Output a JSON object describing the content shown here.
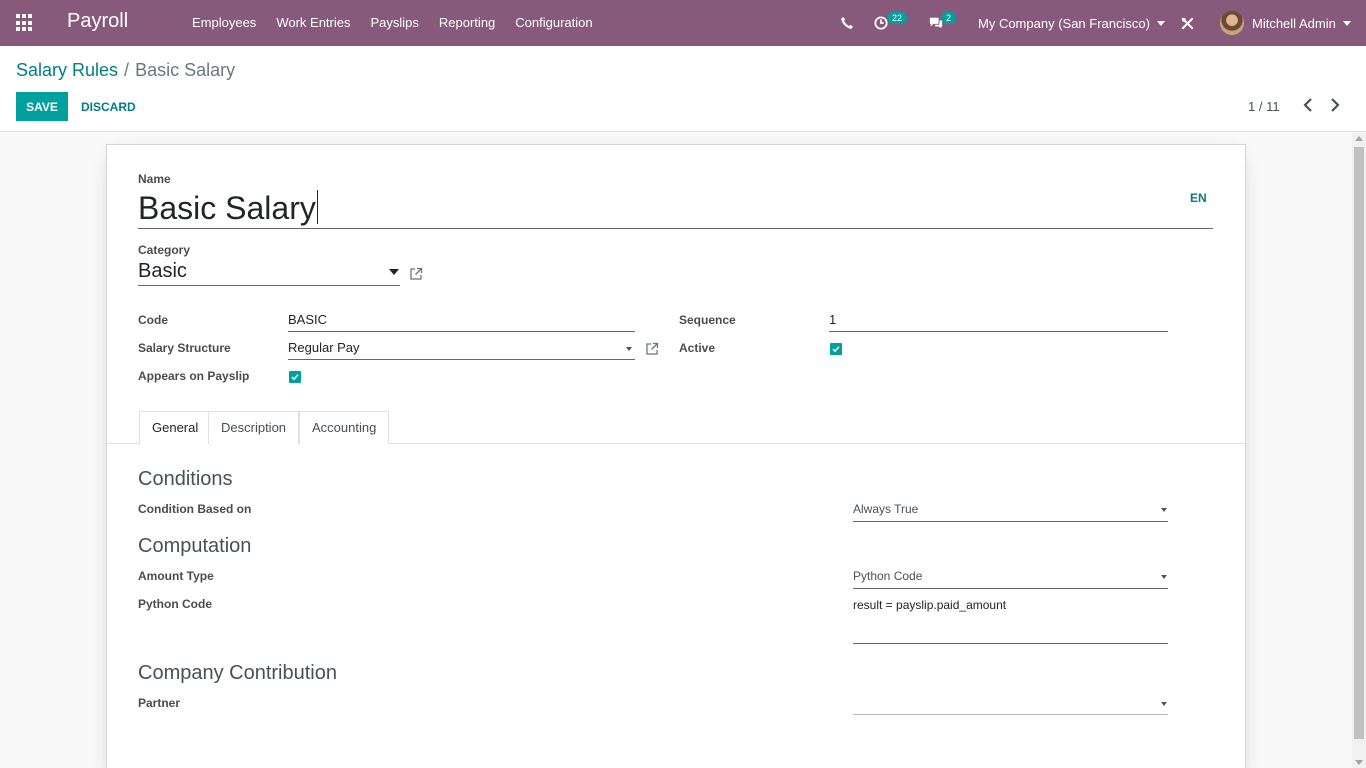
{
  "navbar": {
    "brand": "Payroll",
    "menu": [
      "Employees",
      "Work Entries",
      "Payslips",
      "Reporting",
      "Configuration"
    ],
    "activities_count": "22",
    "messages_count": "2",
    "company": "My Company (San Francisco)",
    "user": "Mitchell Admin"
  },
  "breadcrumb": {
    "parent": "Salary Rules",
    "separator": "/",
    "current": "Basic Salary"
  },
  "actions": {
    "save": "SAVE",
    "discard": "DISCARD"
  },
  "pager": {
    "value": "1 / 11"
  },
  "form": {
    "name_label": "Name",
    "name_value": "Basic Salary",
    "lang": "EN",
    "category_label": "Category",
    "category_value": "Basic",
    "code_label": "Code",
    "code_value": "BASIC",
    "structure_label": "Salary Structure",
    "structure_value": "Regular Pay",
    "appears_label": "Appears on Payslip",
    "appears_checked": true,
    "sequence_label": "Sequence",
    "sequence_value": "1",
    "active_label": "Active",
    "active_checked": true
  },
  "tabs": [
    "General",
    "Description",
    "Accounting"
  ],
  "general": {
    "conditions_title": "Conditions",
    "condition_label": "Condition Based on",
    "condition_value": "Always True",
    "computation_title": "Computation",
    "amount_type_label": "Amount Type",
    "amount_type_value": "Python Code",
    "python_code_label": "Python Code",
    "python_code_value": "result = payslip.paid_amount",
    "contribution_title": "Company Contribution",
    "partner_label": "Partner",
    "partner_value": ""
  },
  "colors": {
    "brand": "#875a7b",
    "accent": "#00a09d",
    "link": "#017e84"
  }
}
